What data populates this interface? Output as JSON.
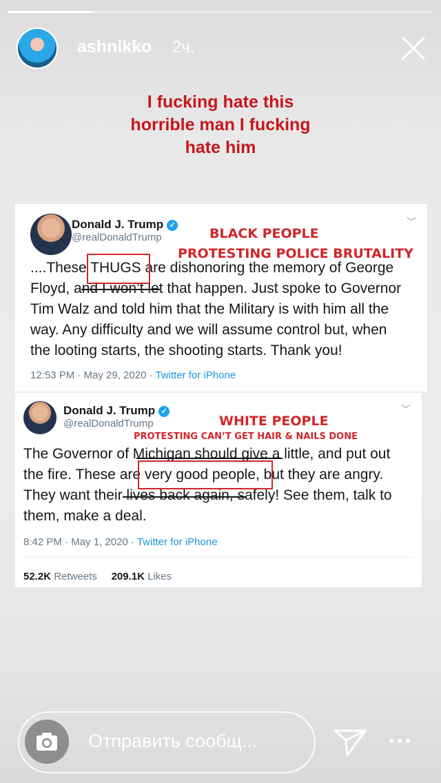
{
  "story": {
    "progress": 0.2,
    "username": "ashnikko",
    "time_ago": "2ч.",
    "caption": [
      "I fucking hate this",
      "horrible man I fucking",
      "hate him"
    ]
  },
  "tweet1": {
    "name": "Donald J. Trump",
    "handle": "@realDonaldTrump",
    "annotation_title": "BLACK PEOPLE",
    "annotation_sub": "PROTESTING POLICE BRUTALITY",
    "lines": [
      "....These THUGS are dishonoring the memory of George",
      "Floyd, and I won’t let that happen. Just spoke to Governor",
      "Tim Walz and told him that the Military is with him all the",
      "way. Any difficulty and we will assume control but, when",
      "the looting starts, the shooting starts. Thank you!"
    ],
    "timestamp": "12:53 PM · May 29, 2020 · ",
    "source": "Twitter for iPhone"
  },
  "tweet2": {
    "name": "Donald J. Trump",
    "handle": "@realDonaldTrump",
    "annotation_title": "WHITE PEOPLE",
    "annotation_sub": "PROTESTING CAN’T GET HAIR & NAILS DONE",
    "lines": [
      "The Governor of Michigan should give a little, and put out",
      "the fire. These are very good people, but they are angry.",
      "They want their lives back again, safely! See them, talk to",
      "them, make a deal."
    ],
    "timestamp": "8:42 PM · May 1, 2020 · ",
    "source": "Twitter for iPhone",
    "retweets": "52.2K",
    "retweets_label": "Retweets",
    "likes": "209.1K",
    "likes_label": "Likes"
  },
  "reply": {
    "placeholder": "Отправить сообщ..."
  }
}
